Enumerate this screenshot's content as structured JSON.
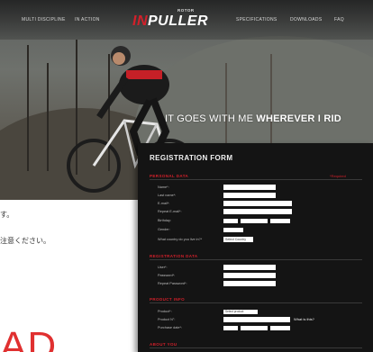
{
  "site": {
    "nav_left": [
      "MULTI DISCIPLINE",
      "IN ACTION"
    ],
    "nav_right": [
      "SPECIFICATIONS",
      "DOWNLOADS",
      "FAQ"
    ],
    "logo_small": "ROTOR",
    "logo_accent": "IN",
    "logo_main": "PULLER",
    "tagline_normal": "IT GOES WITH ME ",
    "tagline_bold": "WHEREVER I RID"
  },
  "page": {
    "jp_line1": "す。",
    "jp_line2": "注意ください。",
    "big_red_text": "AD"
  },
  "form": {
    "title": "REGISTRATION FORM",
    "required_note": "*Required",
    "sections": {
      "personal": "PERSONAL DATA",
      "registration": "REGISTRATION DATA",
      "product": "PRODUCT INFO",
      "about": "ABOUT YOU"
    },
    "personal_labels": [
      "Name*:",
      "Last name*:",
      "E-mail*:",
      "Repeat E-mail*:",
      "Birthday:",
      "Gender:",
      "What country do you live in?*"
    ],
    "country_value": "Select Country",
    "registration_labels": [
      "User*:",
      "Password*:",
      "Repeat Password*:"
    ],
    "product_labels": [
      "Product*:",
      "Product N°:",
      "Purchase date*:"
    ],
    "product_value": "Select product",
    "what_is_this": "What is this?"
  },
  "colors": {
    "accent_red": "#d3202a",
    "form_bg": "#141414"
  }
}
